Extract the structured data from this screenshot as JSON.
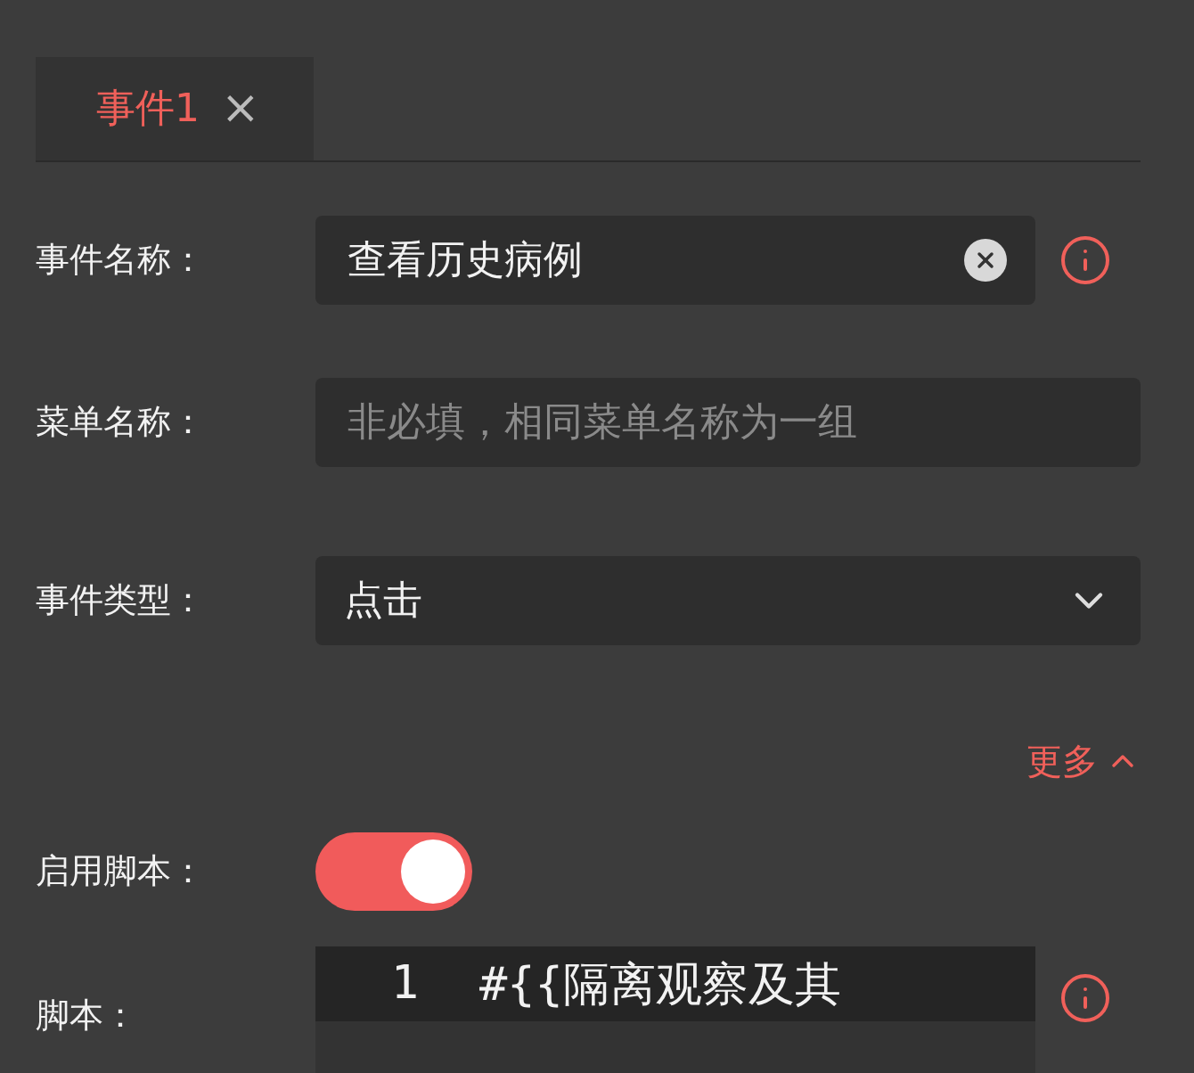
{
  "tabs": [
    {
      "label": "事件1",
      "selected": true,
      "close": "×"
    }
  ],
  "fields": [
    {
      "kind": "text",
      "label": "事件名称：",
      "value": "查看历史病例",
      "clearable": true,
      "info": true
    },
    {
      "kind": "text",
      "label": "菜单名称：",
      "placeholder": "非必填，相同菜单名称为一组",
      "clearable": false,
      "info": false
    },
    {
      "kind": "select",
      "label": "事件类型：",
      "value": "点击",
      "info": false
    }
  ],
  "more": {
    "label": "更多",
    "expanded": true
  },
  "script_toggle": {
    "label": "启用脚本：",
    "on": true
  },
  "script": {
    "label": "脚本：",
    "lines": [
      {
        "number": "1",
        "code": "#{{隔离观察及其"
      }
    ],
    "info": true
  }
}
